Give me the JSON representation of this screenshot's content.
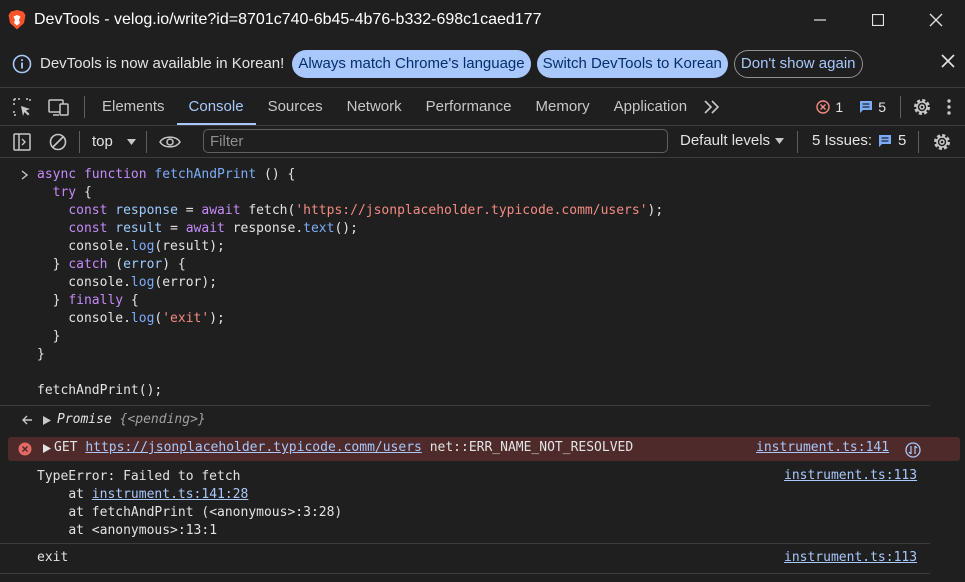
{
  "window": {
    "title": "DevTools - velog.io/write?id=8701c740-6b45-4b76-b332-698c1caed177",
    "controls": {
      "minimize_icon": "minimize-icon",
      "maximize_icon": "maximize-icon",
      "close_icon": "close-icon"
    }
  },
  "infobar": {
    "message": "DevTools is now available in Korean!",
    "button_match": "Always match Chrome's language",
    "button_switch": "Switch DevTools to Korean",
    "button_dismiss": "Don't show again"
  },
  "tabs": {
    "items": [
      "Elements",
      "Console",
      "Sources",
      "Network",
      "Performance",
      "Memory",
      "Application"
    ],
    "active": "Console",
    "error_count": "1",
    "message_count": "5"
  },
  "console_toolbar": {
    "context": "top",
    "filter_placeholder": "Filter",
    "levels": "Default levels",
    "issues_label": "5 Issues:",
    "issues_count": "5"
  },
  "console": {
    "code_line_1": "async function fetchAndPrint () {",
    "code_lines": [
      "async function fetchAndPrint () {",
      "  try {",
      "    const response = await fetch('https://jsonplaceholder.typicode.comm/users');",
      "    const result = await response.text();",
      "    console.log(result);",
      "  } catch (error) {",
      "    console.log(error);",
      "  } finally {",
      "    console.log('exit');",
      "  }",
      "}",
      "",
      "fetchAndPrint();"
    ],
    "promise_label": "Promise",
    "promise_state": "{<pending>}",
    "error": {
      "method": "GET",
      "url": "https://jsonplaceholder.typicode.comm/users",
      "message": "net::ERR_NAME_NOT_RESOLVED",
      "source": "instrument.ts:141"
    },
    "typeerror": {
      "message": "TypeError: Failed to fetch",
      "at1_prefix": "at ",
      "at1_link": "instrument.ts:141:28",
      "at2": "at fetchAndPrint (<anonymous>:3:28)",
      "at3": "at <anonymous>:13:1",
      "source": "instrument.ts:113"
    },
    "exit": {
      "text": "exit",
      "source": "instrument.ts:113"
    }
  }
}
